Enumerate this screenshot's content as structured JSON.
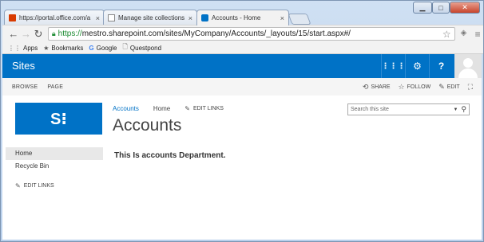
{
  "browser": {
    "tabs": [
      {
        "label": "https://portal.office.com/a",
        "icon": "office-icon",
        "icon_color": "#d83b01"
      },
      {
        "label": "Manage site collections",
        "icon": "page-icon"
      },
      {
        "label": "Accounts - Home",
        "icon": "sharepoint-icon",
        "icon_color": "#0072c6"
      }
    ],
    "url_scheme": "https://",
    "url_rest": "mestro.sharepoint.com/sites/MyCompany/Accounts/_layouts/15/start.aspx#/",
    "bookmarks": [
      {
        "label": "Apps",
        "icon": "apps-icon"
      },
      {
        "label": "Bookmarks",
        "icon": "star-icon"
      },
      {
        "label": "Google",
        "icon": "google-icon"
      },
      {
        "label": "Questpond",
        "icon": "page-icon"
      }
    ]
  },
  "suitebar": {
    "title": "Sites",
    "brand_color": "#0072c6"
  },
  "ribbon": {
    "tabs": [
      "BROWSE",
      "PAGE"
    ],
    "actions": [
      "SHARE",
      "FOLLOW",
      "EDIT"
    ]
  },
  "topnav": {
    "items": [
      "Accounts",
      "Home"
    ],
    "edit_links": "EDIT LINKS"
  },
  "page": {
    "title": "Accounts",
    "body": "This Is accounts Department."
  },
  "search": {
    "placeholder": "Search this site"
  },
  "quicklaunch": {
    "items": [
      "Home",
      "Recycle Bin"
    ],
    "edit_links": "EDIT LINKS"
  }
}
